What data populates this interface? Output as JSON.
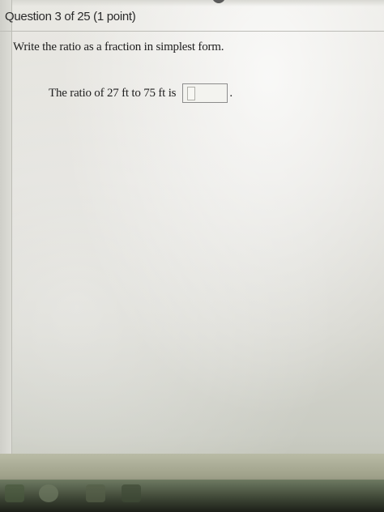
{
  "question": {
    "header": "Question 3 of 25 (1 point)",
    "instruction": "Write the ratio as a fraction in simplest form.",
    "prompt": "The ratio of 27 ft to 75 ft is",
    "answer_value": "",
    "trailing_punctuation": "."
  }
}
